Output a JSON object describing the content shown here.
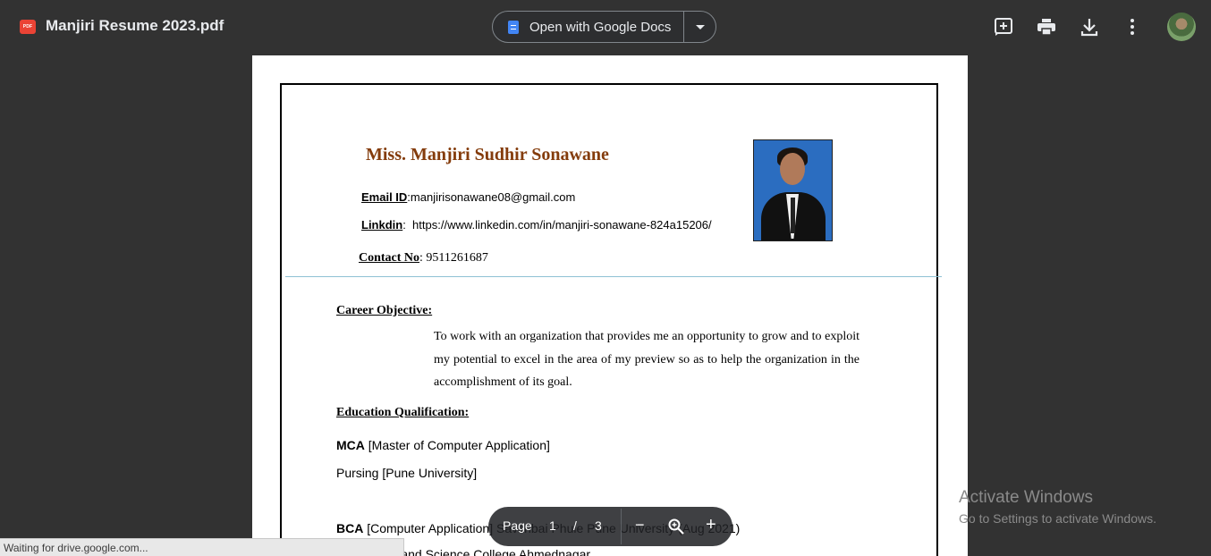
{
  "toolbar": {
    "file_badge": "PDF",
    "file_name": "Manjiri Resume 2023.pdf",
    "open_with_label": "Open with Google Docs"
  },
  "document": {
    "name": "Miss. Manjiri Sudhir Sonawane",
    "email_label": "Email ID",
    "email_value": ":manjirisonawane08@gmail.com",
    "linkedin_label": "Linkdin",
    "linkedin_value": ":  https://www.linkedin.com/in/manjiri-sonawane-824a15206/",
    "contact_label": "Contact No",
    "contact_value": ": 9511261687",
    "career_heading": "Career Objective:",
    "career_text": "To work with an organization that provides me an opportunity to grow and to exploit my potential to excel in the area of my preview so as to help the organization in the accomplishment of its goal.",
    "education_heading": "Education Qualification:",
    "mca_bold": "MCA",
    "mca_rest": " [Master of Computer Application]",
    "mca_status": "Pursing [Pune University]",
    "bca_bold": "BCA",
    "bca_rest": " [Computer Application] Savitribai Phule Pune University (Aug 2021)",
    "college_line": "Commerce and Science College Ahmednagar"
  },
  "zoom_bar": {
    "page_label": "Page",
    "current_page": "1",
    "separator": "/",
    "total_pages": "3",
    "zoom_out": "−",
    "zoom_in": "+"
  },
  "watermark": {
    "line1": "Activate Windows",
    "line2": "Go to Settings to activate Windows."
  },
  "status_bar": {
    "text": "Waiting for drive.google.com..."
  },
  "colors": {
    "background": "#323232",
    "name_color": "#843c0c",
    "divider": "#8fc1d4",
    "docs_blue": "#4285f4",
    "pdf_red": "#ea4335"
  }
}
